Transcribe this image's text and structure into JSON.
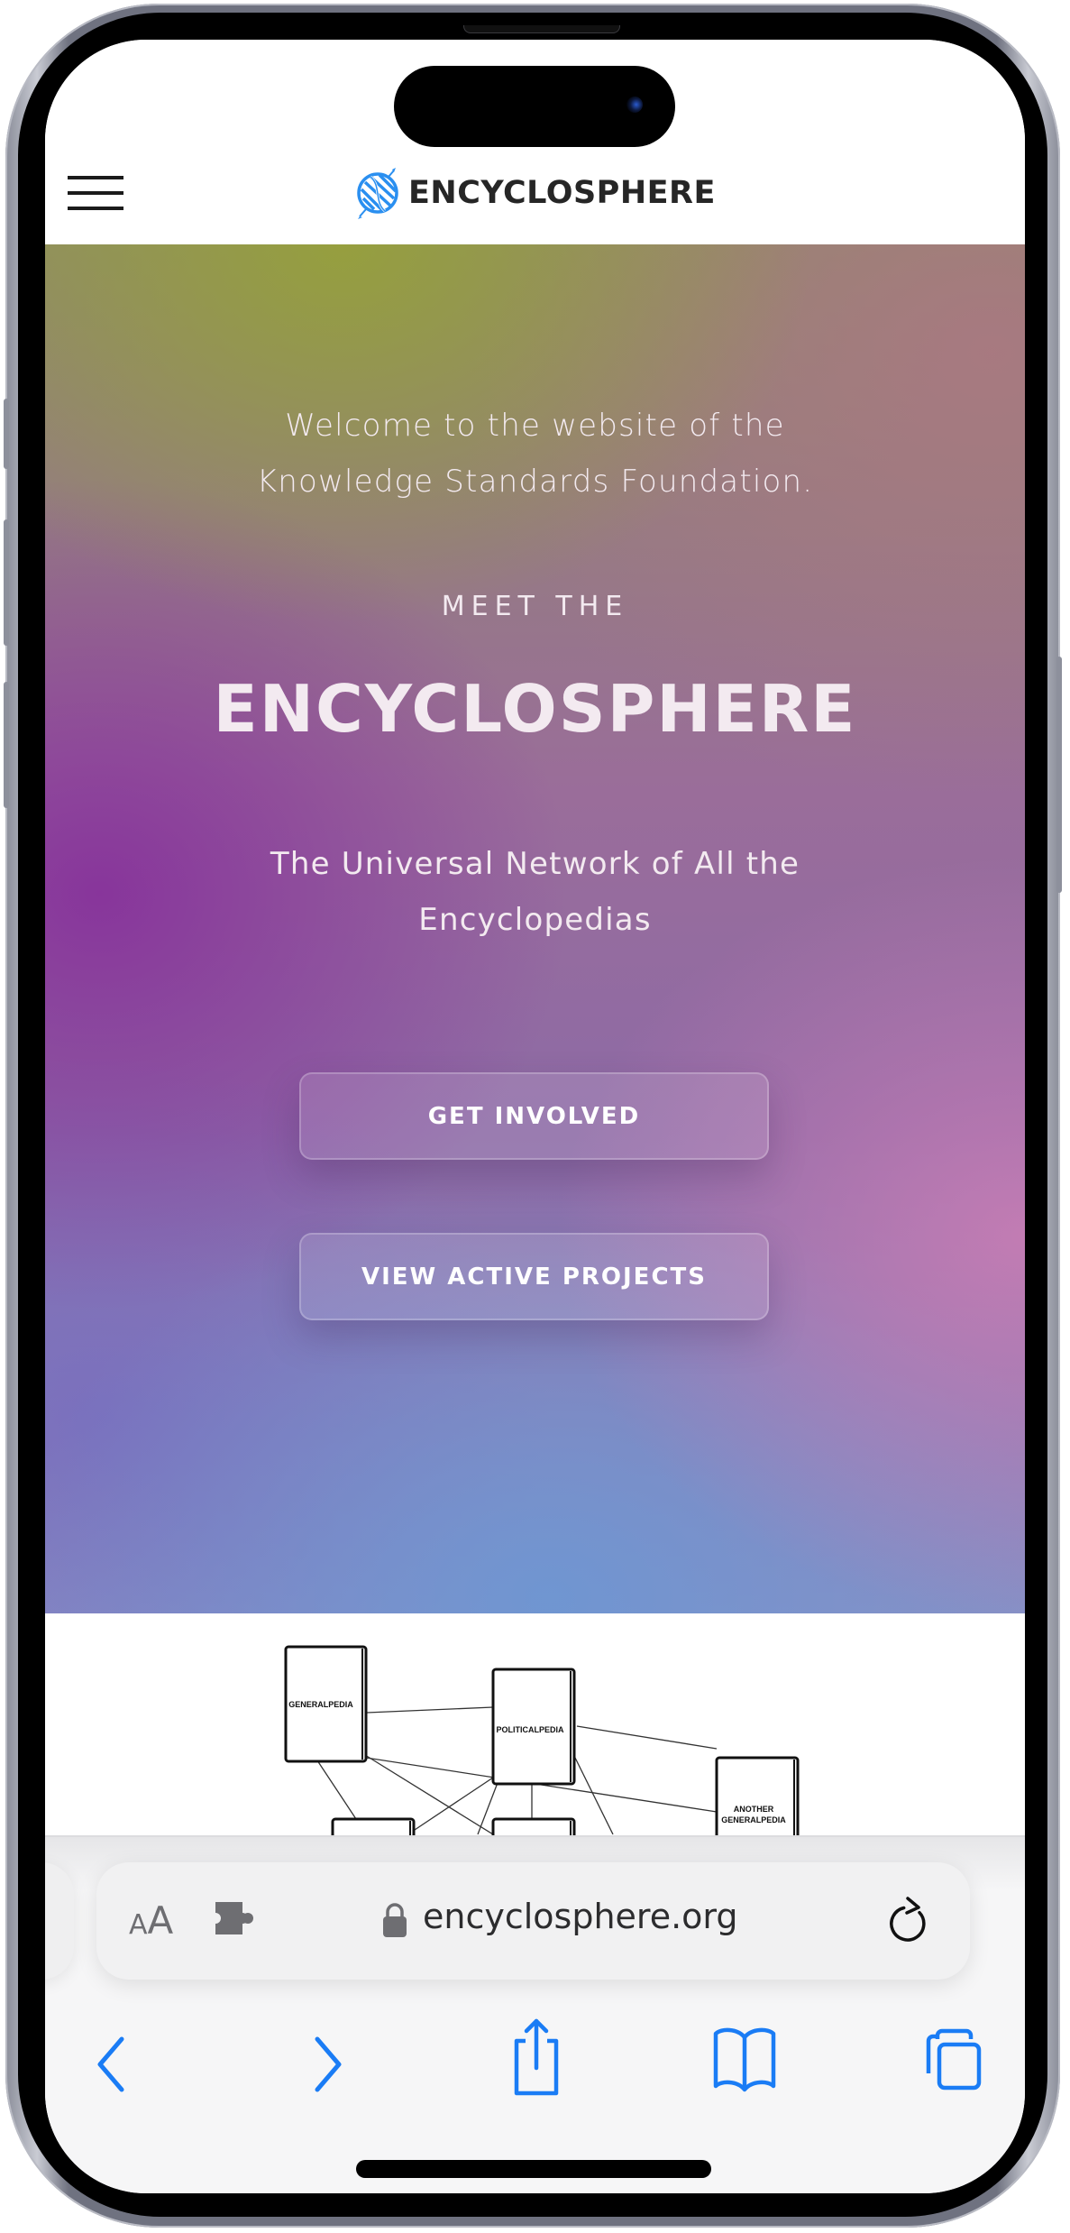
{
  "site": {
    "logo_text": "ENCYCLOSPHERE",
    "menu_icon": "hamburger-icon",
    "logo_icon": "globe-dna-logo-icon"
  },
  "hero": {
    "welcome_lines": [
      "Welcome to the website of the",
      "Knowledge Standards Foundation."
    ],
    "eyebrow": "MEET THE",
    "title": "ENCYCLOSPHERE",
    "tagline_lines": [
      "The Universal Network of All the",
      "Encyclopedias"
    ],
    "buttons": {
      "get_involved": "GET INVOLVED",
      "view_projects": "VIEW ACTIVE PROJECTS"
    }
  },
  "diagram": {
    "nodes": [
      {
        "id": "generalpedia",
        "label": [
          "GENERALPEDIA"
        ]
      },
      {
        "id": "politicalpedia",
        "label": [
          "POLITICALPEDIA"
        ]
      },
      {
        "id": "another-generalpedia",
        "label": [
          "ANOTHER",
          "GENERALPEDIA"
        ]
      },
      {
        "id": "lower-left",
        "label": []
      },
      {
        "id": "lower-middle",
        "label": []
      }
    ]
  },
  "browser": {
    "text_size_label_small": "A",
    "text_size_label_large": "A",
    "url": "encyclosphere.org",
    "icons": {
      "text_size": "text-size-icon",
      "extension": "puzzle-extension-icon",
      "lock": "lock-icon",
      "reload": "reload-icon",
      "back": "chevron-left-icon",
      "forward": "chevron-right-icon",
      "share": "share-icon",
      "bookmarks": "book-icon",
      "tabs": "tabs-icon"
    },
    "accent_color": "#1a7cf5"
  },
  "colors": {
    "header_bg": "#ffffff",
    "logo_blue": "#2a8ff0",
    "logo_text": "#262626",
    "hero_olive": "#969a3c",
    "hero_purple": "#87329b",
    "hero_pink": "#c87db4",
    "hero_blue": "#6e96d2"
  }
}
